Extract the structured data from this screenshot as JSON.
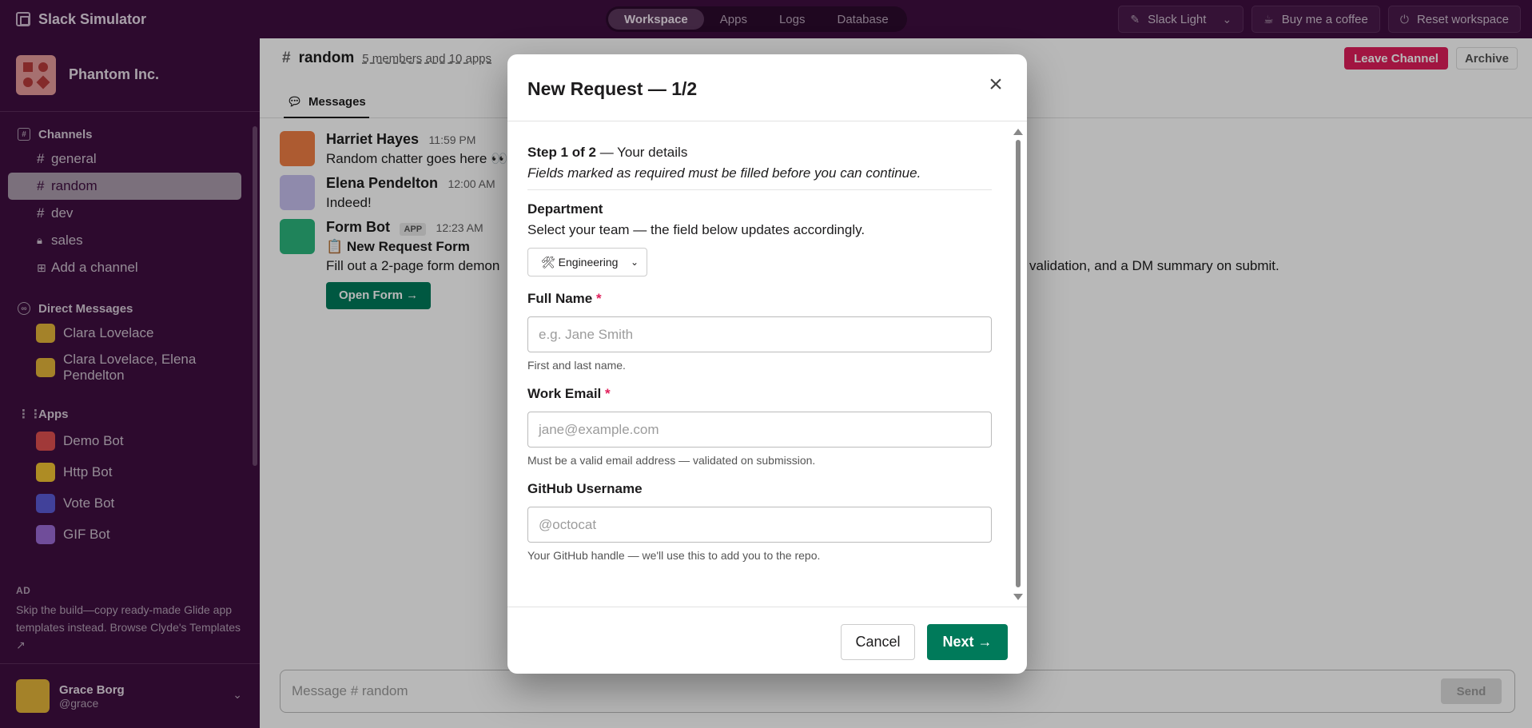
{
  "app": {
    "title": "Slack Simulator"
  },
  "top_nav": {
    "tabs": [
      {
        "label": "Workspace",
        "active": true
      },
      {
        "label": "Apps",
        "active": false
      },
      {
        "label": "Logs",
        "active": false
      },
      {
        "label": "Database",
        "active": false
      }
    ],
    "theme_label": "Slack Light",
    "coffee_label": "Buy me a coffee",
    "reset_label": "Reset workspace"
  },
  "sidebar": {
    "workspace_name": "Phantom Inc.",
    "channels_title": "Channels",
    "channels": [
      {
        "label": "general",
        "private": false,
        "active": false
      },
      {
        "label": "random",
        "private": false,
        "active": true
      },
      {
        "label": "dev",
        "private": false,
        "active": false
      },
      {
        "label": "sales",
        "private": true,
        "active": false
      }
    ],
    "add_channel": "Add a channel",
    "dm_title": "Direct Messages",
    "dms": [
      {
        "label": "Clara Lovelace"
      },
      {
        "label": "Clara Lovelace, Elena Pendelton"
      }
    ],
    "apps_title": "Apps",
    "apps": [
      {
        "label": "Demo Bot",
        "color": "#e05050"
      },
      {
        "label": "Http Bot",
        "color": "#f1c232"
      },
      {
        "label": "Vote Bot",
        "color": "#5b5bd6"
      },
      {
        "label": "GIF Bot",
        "color": "#9b6bd6"
      }
    ],
    "ad": {
      "label": "AD",
      "text": "Skip the build—copy ready-made Glide app templates instead. Browse Clyde's Templates ↗"
    },
    "user": {
      "name": "Grace Borg",
      "handle": "@grace"
    }
  },
  "channel": {
    "name": "random",
    "members": "5 members and 10 apps",
    "leave_label": "Leave Channel",
    "archive_label": "Archive",
    "tab_label": "Messages"
  },
  "messages": [
    {
      "name": "Harriet Hayes",
      "time": "11:59 PM",
      "text": "Random chatter goes here 👀",
      "color": "#f07f45"
    },
    {
      "name": "Elena Pendelton",
      "time": "12:00 AM",
      "text": "Indeed!",
      "color": "#c7c0ef"
    },
    {
      "name": "Form Bot",
      "tag": "APP",
      "time": "12:23 AM",
      "title": "📋 New Request Form",
      "text": "Fill out a 2-page form demon",
      "text_tail": "validation, and a DM summary on submit.",
      "button": "Open Form →",
      "color": "#2cb67d"
    }
  ],
  "composer": {
    "placeholder": "Message # random",
    "send_label": "Send"
  },
  "modal": {
    "title": "New Request — 1/2",
    "step_bold": "Step 1 of 2",
    "step_rest": " — Your details",
    "step_note": "Fields marked as required must be filled before you can continue.",
    "department": {
      "label": "Department",
      "desc": "Select your team — the field below updates accordingly.",
      "value": "🛠 Engineering"
    },
    "full_name": {
      "label": "Full Name",
      "required": "*",
      "placeholder": "e.g. Jane Smith",
      "hint": "First and last name."
    },
    "work_email": {
      "label": "Work Email",
      "required": "*",
      "placeholder": "jane@example.com",
      "hint": "Must be a valid email address — validated on submission."
    },
    "github": {
      "label": "GitHub Username",
      "placeholder": "@octocat",
      "hint": "Your GitHub handle — we'll use this to add you to the repo."
    },
    "cancel_label": "Cancel",
    "next_label": "Next →"
  }
}
